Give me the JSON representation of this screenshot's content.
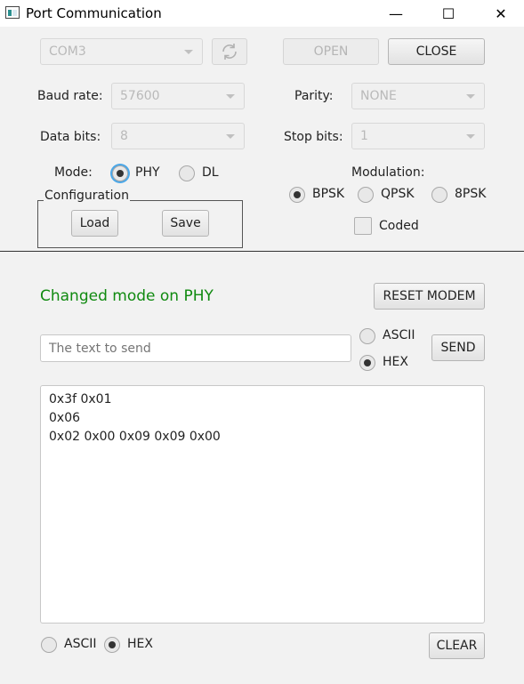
{
  "window": {
    "title": "Port Communication",
    "minimize_glyph": "—",
    "maximize_glyph": "☐",
    "close_glyph": "✕"
  },
  "port": {
    "selected": "COM3",
    "refresh_icon": "refresh-icon",
    "open_label": "OPEN",
    "close_label": "CLOSE"
  },
  "settings": {
    "baud_label": "Baud rate:",
    "baud_value": "57600",
    "parity_label": "Parity:",
    "parity_value": "NONE",
    "databits_label": "Data bits:",
    "databits_value": "8",
    "stopbits_label": "Stop bits:",
    "stopbits_value": "1"
  },
  "mode": {
    "label": "Mode:",
    "options": [
      "PHY",
      "DL"
    ],
    "selected": "PHY"
  },
  "configuration": {
    "title": "Configuration",
    "load_label": "Load",
    "save_label": "Save"
  },
  "modulation": {
    "label": "Modulation:",
    "options": [
      "BPSK",
      "QPSK",
      "8PSK"
    ],
    "selected": "BPSK",
    "coded_label": "Coded",
    "coded_checked": false
  },
  "status": {
    "text": "Changed mode on PHY",
    "color": "#108a10"
  },
  "reset_label": "RESET MODEM",
  "send": {
    "placeholder": "The text to send",
    "ascii_label": "ASCII",
    "hex_label": "HEX",
    "selected": "HEX",
    "send_label": "SEND"
  },
  "output": {
    "lines": [
      "0x3f 0x01",
      "0x06",
      "0x02 0x00 0x09 0x09 0x00"
    ]
  },
  "output_format": {
    "ascii_label": "ASCII",
    "hex_label": "HEX",
    "selected": "HEX"
  },
  "clear_label": "CLEAR"
}
